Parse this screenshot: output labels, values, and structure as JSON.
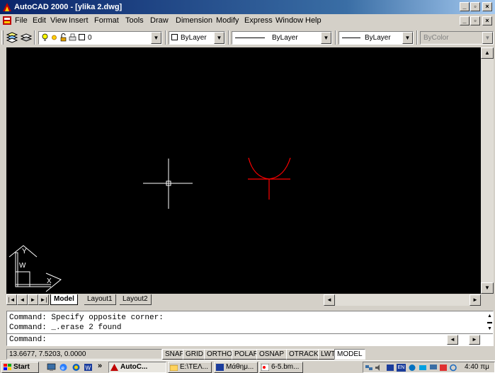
{
  "window": {
    "title": "AutoCAD 2000 - [ylika 2.dwg]",
    "minimize": "_",
    "restore": "▫",
    "close": "×"
  },
  "menu": [
    "File",
    "Edit",
    "View",
    "Insert",
    "Format",
    "Tools",
    "Draw",
    "Dimension",
    "Modify",
    "Express",
    "Window",
    "Help"
  ],
  "layers_toolbar": {
    "current_layer": "0",
    "color": "ByLayer",
    "linetype": "ByLayer",
    "lineweight": "ByLayer",
    "plotstyle": "ByColor"
  },
  "tabs": [
    "Model",
    "Layout1",
    "Layout2"
  ],
  "nav_buttons": [
    "|◄",
    "◄",
    "►",
    "►|"
  ],
  "ucs": {
    "y": "Y",
    "w": "W",
    "x": "X"
  },
  "command": {
    "lines": [
      "Command: Specify opposite corner:",
      "Command: _.erase 2 found",
      "Command:"
    ]
  },
  "status": {
    "coords": "13.6677, 7.5203, 0.0000",
    "toggles": [
      "SNAP",
      "GRID",
      "ORTHO",
      "POLAR",
      "OSNAP",
      "OTRACK",
      "LWT",
      "MODEL"
    ]
  },
  "taskbar": {
    "start": "Start",
    "chevron": "»",
    "tasks": [
      "AutoC...",
      "E:\\ΤΕΛ...",
      "Μάθημ...",
      "6-5.bm..."
    ],
    "clock": "4:40 πμ",
    "tray_lang": "EN"
  },
  "colors": {
    "canvas": "#000000",
    "drawing": "#ff0000",
    "crosshair": "#ffffff",
    "titlebar": "#0a246a"
  }
}
